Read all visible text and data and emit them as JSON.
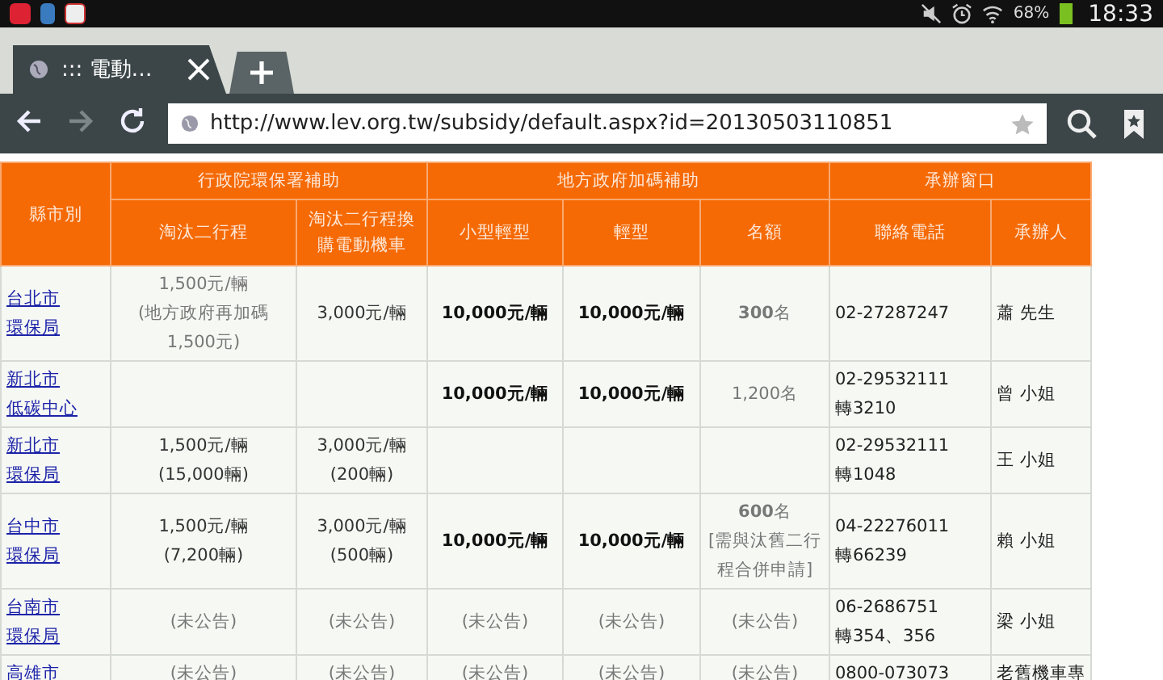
{
  "status_bar": {
    "time": "18:33",
    "battery": "68%"
  },
  "tabs": [
    {
      "title": "::: 電動…",
      "selected": true
    }
  ],
  "nav": [
    {
      "kind": "back",
      "disabled": false
    },
    {
      "kind": "forward",
      "disabled": true
    },
    {
      "kind": "reload",
      "disabled": false
    }
  ],
  "address_bar": {
    "value": "http://www.lev.org.tw/subsidy/default.aspx?id=20130503110851"
  },
  "table": {
    "row_header": "縣市別",
    "groups": [
      {
        "label": "行政院環保署補助",
        "columns": [
          {
            "lines": [
              "淘汰二行程"
            ]
          },
          {
            "lines": [
              "淘汰二行程換",
              "購電動機車"
            ]
          }
        ]
      },
      {
        "label": "地方政府加碼補助",
        "columns": [
          {
            "lines": [
              "小型輕型"
            ]
          },
          {
            "lines": [
              "輕型"
            ]
          },
          {
            "lines": [
              "名額"
            ]
          }
        ]
      },
      {
        "label": "承辦窗口",
        "columns": [
          {
            "lines": [
              "聯絡電話"
            ]
          },
          {
            "lines": [
              "承辦人"
            ]
          }
        ]
      }
    ],
    "rows": [
      {
        "cells": [
          {
            "kind": "link",
            "lines": [
              "台北市",
              "環保局"
            ]
          },
          {
            "kind": "muted",
            "lines": [
              "1,500元/輛",
              "(地方政府再加碼",
              "1,500元)"
            ]
          },
          {
            "kind": "plain",
            "lines": [
              "3,000元/輛"
            ]
          },
          {
            "kind": "bold",
            "lines": [
              "10,000元/輛"
            ]
          },
          {
            "kind": "bold",
            "lines": [
              "10,000元/輛"
            ]
          },
          {
            "kind": "muted",
            "lines": [
              "**300**名"
            ]
          },
          {
            "kind": "left",
            "lines": [
              "02-27287247"
            ]
          },
          {
            "kind": "left",
            "lines": [
              "蕭 先生"
            ]
          }
        ]
      },
      {
        "cells": [
          {
            "kind": "link",
            "lines": [
              "新北市",
              "低碳中心"
            ]
          },
          {
            "kind": "empty"
          },
          {
            "kind": "empty"
          },
          {
            "kind": "bold",
            "lines": [
              "10,000元/輛"
            ]
          },
          {
            "kind": "bold",
            "lines": [
              "10,000元/輛"
            ]
          },
          {
            "kind": "muted",
            "lines": [
              "1,200名"
            ]
          },
          {
            "kind": "left",
            "lines": [
              "02-29532111",
              "轉3210"
            ]
          },
          {
            "kind": "left",
            "lines": [
              "曾 小姐"
            ]
          }
        ]
      },
      {
        "cells": [
          {
            "kind": "link",
            "lines": [
              "新北市",
              "環保局"
            ]
          },
          {
            "kind": "plain",
            "lines": [
              "1,500元/輛",
              "(15,000輛)"
            ]
          },
          {
            "kind": "plain",
            "lines": [
              "3,000元/輛",
              "(200輛)"
            ]
          },
          {
            "kind": "empty"
          },
          {
            "kind": "empty"
          },
          {
            "kind": "empty"
          },
          {
            "kind": "left",
            "lines": [
              "02-29532111",
              "轉1048"
            ]
          },
          {
            "kind": "left",
            "lines": [
              "王 小姐"
            ]
          }
        ]
      },
      {
        "cells": [
          {
            "kind": "link",
            "lines": [
              "台中市",
              "環保局"
            ]
          },
          {
            "kind": "plain",
            "lines": [
              "1,500元/輛",
              "(7,200輛)"
            ]
          },
          {
            "kind": "plain",
            "lines": [
              "3,000元/輛",
              "(500輛)"
            ]
          },
          {
            "kind": "bold",
            "lines": [
              "10,000元/輛"
            ]
          },
          {
            "kind": "bold",
            "lines": [
              "10,000元/輛"
            ]
          },
          {
            "kind": "muted",
            "lines": [
              "**600**名",
              "[需與汰舊二行",
              "程合併申請]"
            ]
          },
          {
            "kind": "left",
            "lines": [
              "04-22276011",
              "轉66239"
            ]
          },
          {
            "kind": "left",
            "lines": [
              "賴 小姐"
            ]
          }
        ]
      },
      {
        "cells": [
          {
            "kind": "link",
            "lines": [
              "台南市",
              "環保局"
            ]
          },
          {
            "kind": "muted",
            "lines": [
              "(未公告)"
            ]
          },
          {
            "kind": "muted",
            "lines": [
              "(未公告)"
            ]
          },
          {
            "kind": "muted",
            "lines": [
              "(未公告)"
            ]
          },
          {
            "kind": "muted",
            "lines": [
              "(未公告)"
            ]
          },
          {
            "kind": "muted",
            "lines": [
              "(未公告)"
            ]
          },
          {
            "kind": "left",
            "lines": [
              "06-2686751",
              "轉354、356"
            ]
          },
          {
            "kind": "left",
            "lines": [
              "梁 小姐"
            ]
          }
        ]
      },
      {
        "cells": [
          {
            "kind": "link",
            "lines": [
              "高雄市"
            ]
          },
          {
            "kind": "muted",
            "lines": [
              "(未公告)"
            ]
          },
          {
            "kind": "muted",
            "lines": [
              "(未公告)"
            ]
          },
          {
            "kind": "muted",
            "lines": [
              "(未公告)"
            ]
          },
          {
            "kind": "muted",
            "lines": [
              "(未公告)"
            ]
          },
          {
            "kind": "muted",
            "lines": [
              "(未公告)"
            ]
          },
          {
            "kind": "left",
            "lines": [
              "0800-073073"
            ]
          },
          {
            "kind": "left",
            "lines": [
              "老舊機車專"
            ]
          }
        ]
      }
    ]
  }
}
